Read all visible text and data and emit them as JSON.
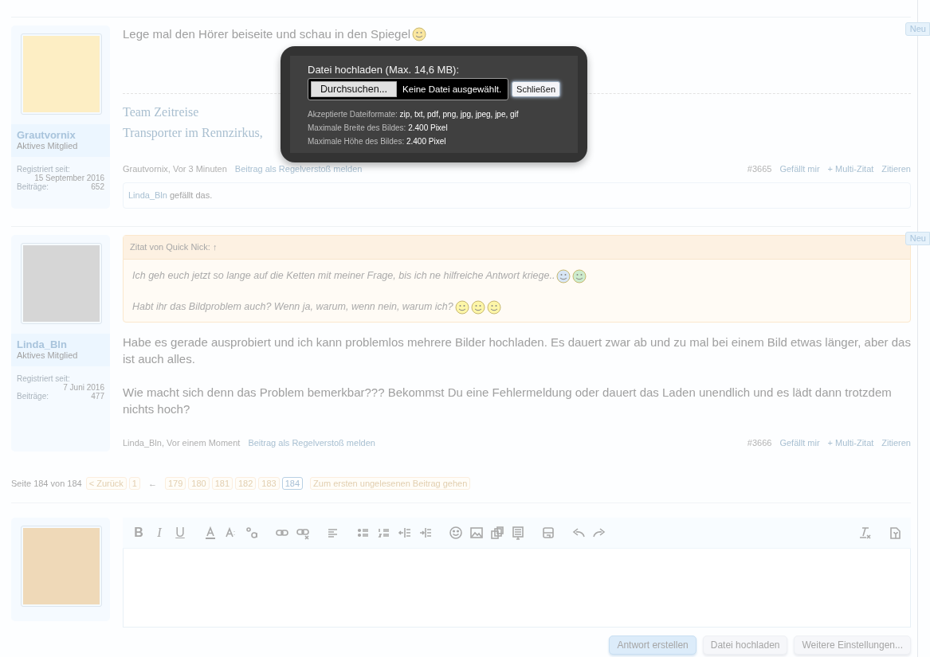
{
  "posts": [
    {
      "badge": "Neu",
      "author": "Grautvornix",
      "rank": "Aktives Mitglied",
      "stats": [
        {
          "label": "Registriert seit:",
          "value": "15 September 2016"
        },
        {
          "label": "Beiträge:",
          "value": "652"
        }
      ],
      "paragraphs": [
        {
          "text": "Lege mal den Hörer beiseite und schau in den Spiegel",
          "emoji": true
        }
      ],
      "signature": [
        "Team Zeitreise",
        "Transporter im Rennzirkus,"
      ],
      "meta": {
        "byline": "Grautvornix, Vor 3 Minuten",
        "report": "Beitrag als Regelverstoß melden",
        "number": "#3665",
        "actions": [
          "Gefällt mir",
          "+ Multi-Zitat",
          "Zitieren"
        ]
      },
      "likes": {
        "user": "Linda_Bln",
        "text": "gefällt das."
      }
    },
    {
      "badge": "Neu",
      "author": "Linda_Bln",
      "rank": "Aktives Mitglied",
      "stats": [
        {
          "label": "Registriert seit:",
          "value": "7 Juni 2016"
        },
        {
          "label": "Beiträge:",
          "value": "477"
        }
      ],
      "quote": {
        "author": "Zitat von Quick Nick:",
        "jump": "↑",
        "lines": [
          "Ich geh euch jetzt so lange auf die Ketten mit meiner Frage, bis ich ne hilfreiche Antwort kriege..",
          "Habt ihr das Bildproblem auch? Wenn ja, warum, wenn nein, warum ich?"
        ]
      },
      "paragraphs": [
        {
          "text": "Habe es gerade ausprobiert und ich kann problemlos mehrere Bilder hochladen. Es dauert zwar ab und zu mal bei einem Bild etwas länger, aber das ist auch alles."
        },
        {
          "text": "Wie macht sich denn das Problem bemerkbar??? Bekommst Du eine Fehlermeldung oder dauert das Laden unendlich und es lädt dann trotzdem nichts hoch?"
        }
      ],
      "meta": {
        "byline": "Linda_Bln, Vor einem Moment",
        "report": "Beitrag als Regelverstoß melden",
        "number": "#3666",
        "actions": [
          "Gefällt mir",
          "+ Multi-Zitat",
          "Zitieren"
        ]
      }
    }
  ],
  "pagination": {
    "label": "Seite 184 von 184",
    "prev": "< Zurück",
    "first": "1",
    "arrow": "←",
    "pages": [
      {
        "label": "179",
        "selected": false
      },
      {
        "label": "180",
        "selected": false
      },
      {
        "label": "181",
        "selected": false
      },
      {
        "label": "182",
        "selected": false
      },
      {
        "label": "183",
        "selected": false
      },
      {
        "label": "184",
        "selected": true
      }
    ],
    "jump": "Zum ersten ungelesenen Beitrag gehen"
  },
  "editor": {
    "toolbar": [
      [
        {
          "kind": "bold",
          "glyph": "B"
        },
        {
          "kind": "italic",
          "glyph": "I"
        },
        {
          "kind": "underline",
          "glyph": "U"
        }
      ],
      [
        {
          "kind": "font-color"
        },
        {
          "kind": "font-size"
        },
        {
          "kind": "font-family"
        }
      ],
      [
        {
          "kind": "link"
        },
        {
          "kind": "unlink"
        }
      ],
      [
        {
          "kind": "align"
        }
      ],
      [
        {
          "kind": "bullets"
        },
        {
          "kind": "numbers"
        },
        {
          "kind": "outdent"
        },
        {
          "kind": "indent"
        }
      ],
      [
        {
          "kind": "smiley"
        },
        {
          "kind": "image"
        },
        {
          "kind": "media"
        },
        {
          "kind": "table"
        }
      ],
      [
        {
          "kind": "save"
        }
      ],
      [
        {
          "kind": "undo"
        },
        {
          "kind": "redo"
        }
      ]
    ],
    "toolbar_right": [
      {
        "kind": "clear-format"
      },
      {
        "kind": "source"
      }
    ],
    "buttons": [
      {
        "label": "Antwort erstellen",
        "primary": true
      },
      {
        "label": "Datei hochladen",
        "primary": false
      },
      {
        "label": "Weitere Einstellungen...",
        "primary": false
      }
    ]
  },
  "modal": {
    "title": "Datei hochladen (Max. 14,6 MB):",
    "browse": "Durchsuchen...",
    "file_status": "Keine Datei ausgewählt.",
    "close": "Schließen",
    "info": [
      {
        "label": "Akzeptierte Dateiformate:",
        "value": "zip, txt, pdf, png, jpg, jpeg, jpe, gif"
      },
      {
        "label": "Maximale Breite des Bildes:",
        "value": "2.400 Pixel"
      },
      {
        "label": "Maximale Höhe des Bildes:",
        "value": "2.400 Pixel"
      }
    ]
  }
}
